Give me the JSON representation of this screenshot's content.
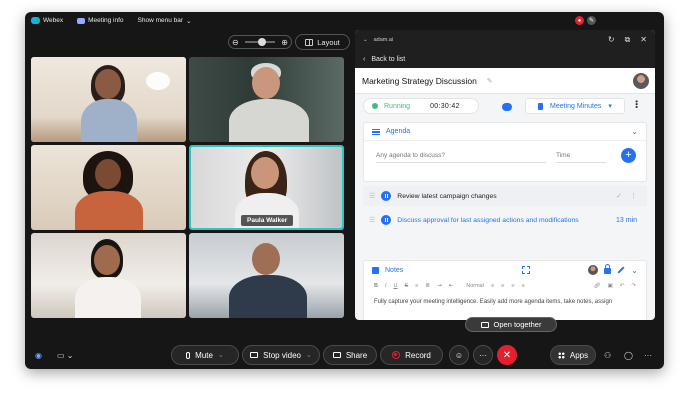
{
  "topbar": {
    "app_name": "Webex",
    "meeting_info": "Meeting info",
    "show_menu_bar": "Show menu bar"
  },
  "stage": {
    "layout_label": "Layout"
  },
  "tiles": [
    {
      "name": ""
    },
    {
      "name": ""
    },
    {
      "name": ""
    },
    {
      "name": "Paula Walker"
    },
    {
      "name": ""
    },
    {
      "name": ""
    }
  ],
  "panel": {
    "app_label": "adam.ai",
    "back_label": "Back to list",
    "meeting_title": "Marketing Strategy Discussion",
    "status_label": "Running",
    "timer": "00:30:42",
    "minutes_label": "Meeting Minutes",
    "agenda": {
      "header": "Agenda",
      "input_placeholder": "Any agenda to discuss?",
      "time_placeholder": "Time",
      "items": [
        {
          "text": "Review latest campaign changes",
          "duration": ""
        },
        {
          "text": "Discuss approval for last assigned actions and modifications",
          "duration": "13 min"
        }
      ]
    },
    "notes": {
      "header": "Notes",
      "format_label": "Normal",
      "body": "Fully capture your meeting intelligence. Easily add more agenda items, take notes, assign"
    },
    "open_together_label": "Open together"
  },
  "controls": {
    "mute_label": "Mute",
    "stop_video_label": "Stop video",
    "share_label": "Share",
    "record_label": "Record",
    "apps_label": "Apps"
  },
  "colors": {
    "accent": "#2471f5",
    "end_call": "#e5202e",
    "running": "#3fbf7f",
    "active_speaker": "#2ec4c4"
  }
}
